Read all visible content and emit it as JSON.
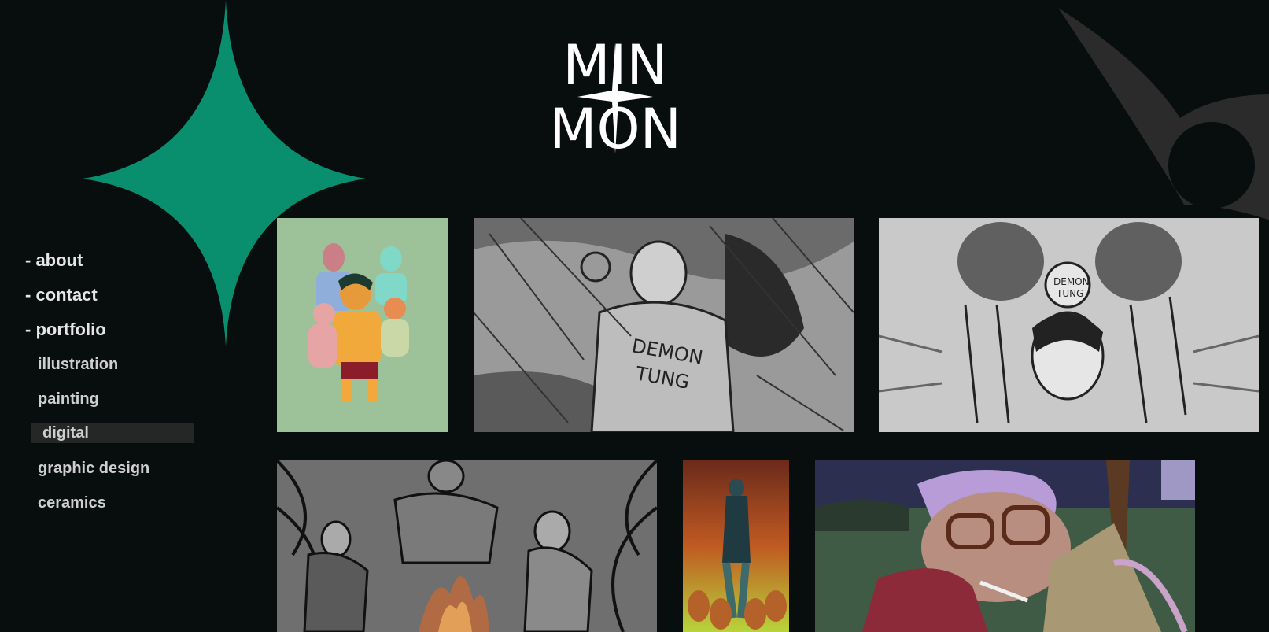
{
  "logo": {
    "line1": "MIN",
    "line2": "MON"
  },
  "nav": {
    "about": "- about",
    "contact": "- contact",
    "portfolio": "- portfolio",
    "sub": {
      "illustration": "illustration",
      "painting": "painting",
      "digital": "digital",
      "graphic_design": "graphic design",
      "ceramics": "ceramics"
    },
    "active": "digital"
  },
  "gallery": [
    {
      "name": "pixel-family-portrait"
    },
    {
      "name": "demon-tung-sketch"
    },
    {
      "name": "demon-tung-band-sketch"
    },
    {
      "name": "campfire-sketch"
    },
    {
      "name": "fire-dogs-painting"
    },
    {
      "name": "old-man-smoking-illustration"
    }
  ],
  "colors": {
    "background": "#080d0d",
    "accent_star": "#0a8f6e",
    "gray_star": "#2b2b2b",
    "active_bg": "#252727"
  }
}
